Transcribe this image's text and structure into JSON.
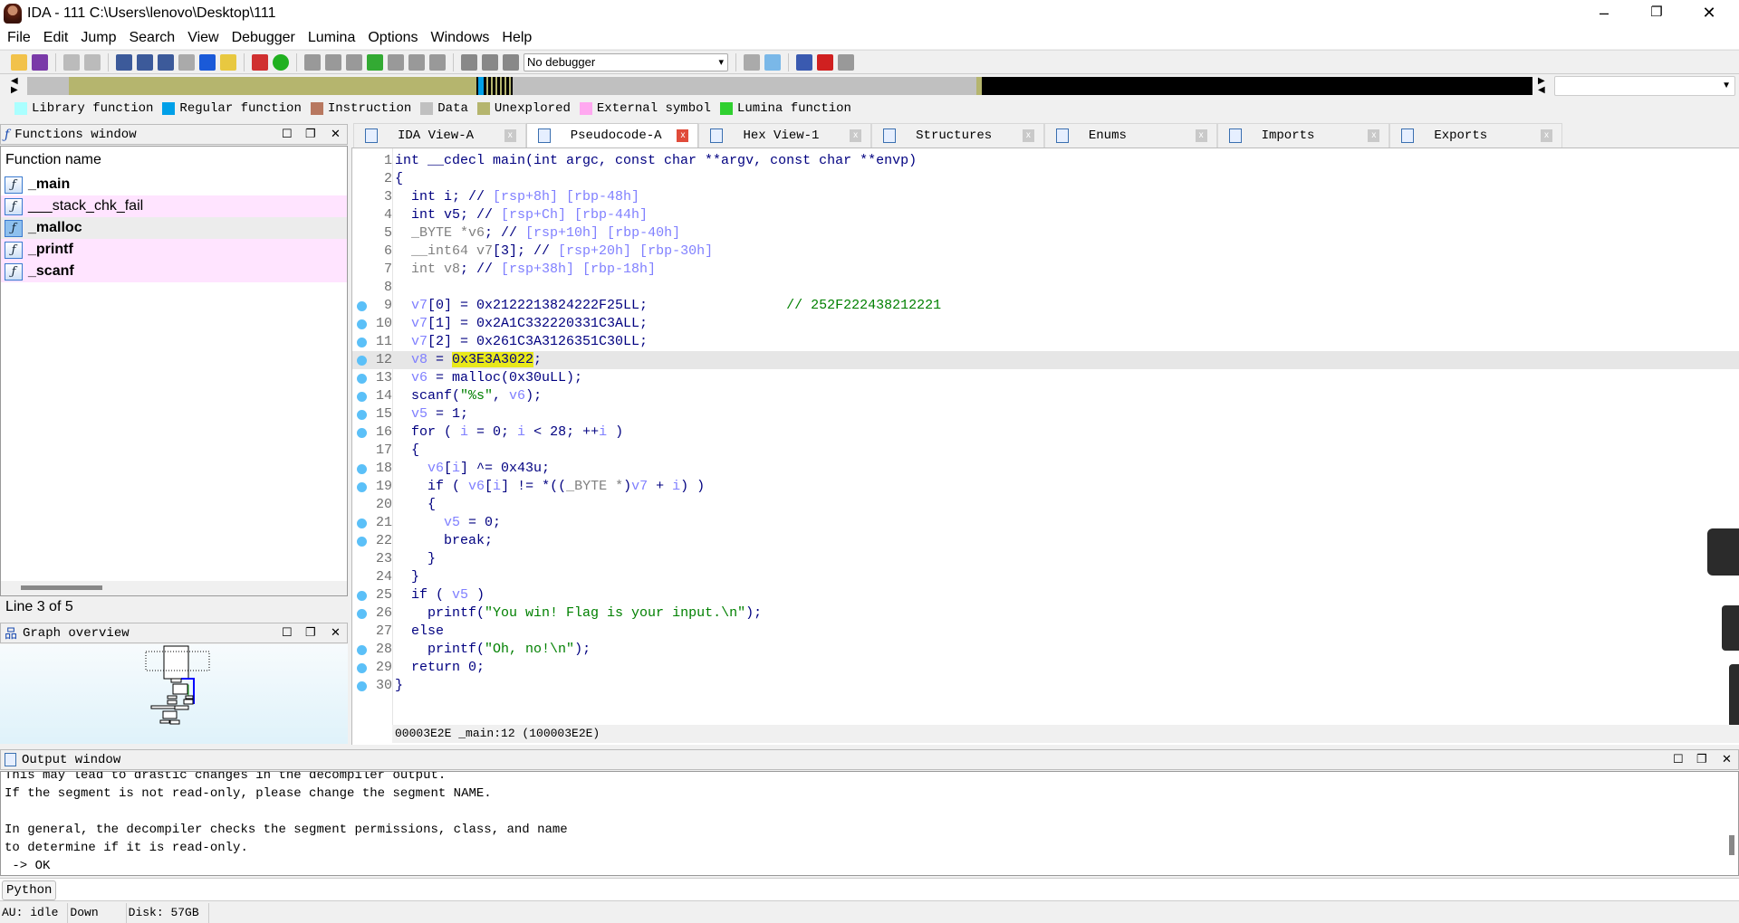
{
  "window": {
    "title": "IDA - 111 C:\\Users\\lenovo\\Desktop\\111",
    "minimize": "–",
    "maximize": "❐",
    "close": "✕"
  },
  "menu": [
    "File",
    "Edit",
    "Jump",
    "Search",
    "View",
    "Debugger",
    "Lumina",
    "Options",
    "Windows",
    "Help"
  ],
  "toolbar": {
    "debugger_select": "No debugger"
  },
  "legend": [
    {
      "label": "Library function",
      "color": "#aaffff"
    },
    {
      "label": "Regular function",
      "color": "#00a0e8"
    },
    {
      "label": "Instruction",
      "color": "#b87860"
    },
    {
      "label": "Data",
      "color": "#c0c0c0"
    },
    {
      "label": "Unexplored",
      "color": "#b5b56e"
    },
    {
      "label": "External symbol",
      "color": "#ffa8f0"
    },
    {
      "label": "Lumina function",
      "color": "#30d030"
    }
  ],
  "functions_window": {
    "title": "Functions window",
    "column": "Function name",
    "status": "Line 3 of 5",
    "items": [
      {
        "name": "_main",
        "bold": true,
        "bg": "#ffffff"
      },
      {
        "name": "___stack_chk_fail",
        "bold": false,
        "bg": "#ffe4ff"
      },
      {
        "name": "_malloc",
        "bold": true,
        "bg": "#ececec"
      },
      {
        "name": "_printf",
        "bold": true,
        "bg": "#ffe4ff"
      },
      {
        "name": "_scanf",
        "bold": true,
        "bg": "#ffe4ff"
      }
    ]
  },
  "graph_overview": {
    "title": "Graph overview"
  },
  "tabs": [
    {
      "label": "IDA View-A",
      "active": false
    },
    {
      "label": "Pseudocode-A",
      "active": true
    },
    {
      "label": "Hex View-1",
      "active": false
    },
    {
      "label": "Structures",
      "active": false
    },
    {
      "label": "Enums",
      "active": false
    },
    {
      "label": "Imports",
      "active": false
    },
    {
      "label": "Exports",
      "active": false
    }
  ],
  "code": {
    "current_line": 12,
    "lines": [
      {
        "n": 1,
        "bp": false,
        "seg": [
          [
            "k",
            "int __cdecl main(int argc, const char **argv, const char **envp)"
          ]
        ]
      },
      {
        "n": 2,
        "bp": false,
        "seg": [
          [
            "k",
            "{"
          ]
        ]
      },
      {
        "n": 3,
        "bp": false,
        "seg": [
          [
            "k",
            "  int i; // "
          ],
          [
            "cb",
            "[rsp+8h] [rbp-48h]"
          ]
        ]
      },
      {
        "n": 4,
        "bp": false,
        "seg": [
          [
            "k",
            "  int v5; // "
          ],
          [
            "cb",
            "[rsp+Ch] [rbp-44h]"
          ]
        ]
      },
      {
        "n": 5,
        "bp": false,
        "seg": [
          [
            "g",
            "  _BYTE *v6"
          ],
          [
            "k",
            "; // "
          ],
          [
            "cb",
            "[rsp+10h] [rbp-40h]"
          ]
        ]
      },
      {
        "n": 6,
        "bp": false,
        "seg": [
          [
            "g",
            "  __int64 v7"
          ],
          [
            "k",
            "[3]; // "
          ],
          [
            "cb",
            "[rsp+20h] [rbp-30h]"
          ]
        ]
      },
      {
        "n": 7,
        "bp": false,
        "seg": [
          [
            "g",
            "  int v8"
          ],
          [
            "k",
            "; // "
          ],
          [
            "cb",
            "[rsp+38h] [rbp-18h]"
          ]
        ]
      },
      {
        "n": 8,
        "bp": false,
        "seg": []
      },
      {
        "n": 9,
        "bp": true,
        "seg": [
          [
            "v",
            "  v7"
          ],
          [
            "k",
            "[0] = 0x2122213824222F25LL;                 "
          ],
          [
            "c",
            "// 252F222438212221"
          ]
        ]
      },
      {
        "n": 10,
        "bp": true,
        "seg": [
          [
            "v",
            "  v7"
          ],
          [
            "k",
            "[1] = 0x2A1C332220331C3ALL;"
          ]
        ]
      },
      {
        "n": 11,
        "bp": true,
        "seg": [
          [
            "v",
            "  v7"
          ],
          [
            "k",
            "[2] = 0x261C3A3126351C30LL;"
          ]
        ]
      },
      {
        "n": 12,
        "bp": true,
        "seg": [
          [
            "v",
            "  v8"
          ],
          [
            "k",
            " = "
          ],
          [
            "hl",
            "0x3E3A3022"
          ],
          [
            "k",
            ";"
          ]
        ]
      },
      {
        "n": 13,
        "bp": true,
        "seg": [
          [
            "v",
            "  v6"
          ],
          [
            "k",
            " = malloc(0x30uLL);"
          ]
        ]
      },
      {
        "n": 14,
        "bp": true,
        "seg": [
          [
            "k",
            "  scanf("
          ],
          [
            "s",
            "\"%s\""
          ],
          [
            "k",
            ", "
          ],
          [
            "v",
            "v6"
          ],
          [
            "k",
            ");"
          ]
        ]
      },
      {
        "n": 15,
        "bp": true,
        "seg": [
          [
            "v",
            "  v5"
          ],
          [
            "k",
            " = 1;"
          ]
        ]
      },
      {
        "n": 16,
        "bp": true,
        "seg": [
          [
            "k",
            "  for ( "
          ],
          [
            "v",
            "i"
          ],
          [
            "k",
            " = 0; "
          ],
          [
            "v",
            "i"
          ],
          [
            "k",
            " < 28; ++"
          ],
          [
            "v",
            "i"
          ],
          [
            "k",
            " )"
          ]
        ]
      },
      {
        "n": 17,
        "bp": false,
        "seg": [
          [
            "k",
            "  {"
          ]
        ]
      },
      {
        "n": 18,
        "bp": true,
        "seg": [
          [
            "v",
            "    v6"
          ],
          [
            "k",
            "["
          ],
          [
            "v",
            "i"
          ],
          [
            "k",
            "] ^= 0x43u;"
          ]
        ]
      },
      {
        "n": 19,
        "bp": true,
        "seg": [
          [
            "k",
            "    if ( "
          ],
          [
            "v",
            "v6"
          ],
          [
            "k",
            "["
          ],
          [
            "v",
            "i"
          ],
          [
            "k",
            "] != *(("
          ],
          [
            "g",
            "_BYTE *"
          ],
          [
            "k",
            ")"
          ],
          [
            "v",
            "v7"
          ],
          [
            "k",
            " + "
          ],
          [
            "v",
            "i"
          ],
          [
            "k",
            ") )"
          ]
        ]
      },
      {
        "n": 20,
        "bp": false,
        "seg": [
          [
            "k",
            "    {"
          ]
        ]
      },
      {
        "n": 21,
        "bp": true,
        "seg": [
          [
            "v",
            "      v5"
          ],
          [
            "k",
            " = 0;"
          ]
        ]
      },
      {
        "n": 22,
        "bp": true,
        "seg": [
          [
            "k",
            "      break;"
          ]
        ]
      },
      {
        "n": 23,
        "bp": false,
        "seg": [
          [
            "k",
            "    }"
          ]
        ]
      },
      {
        "n": 24,
        "bp": false,
        "seg": [
          [
            "k",
            "  }"
          ]
        ]
      },
      {
        "n": 25,
        "bp": true,
        "seg": [
          [
            "k",
            "  if ( "
          ],
          [
            "v",
            "v5"
          ],
          [
            "k",
            " )"
          ]
        ]
      },
      {
        "n": 26,
        "bp": true,
        "seg": [
          [
            "k",
            "    printf("
          ],
          [
            "s",
            "\"You win! Flag is your input.\\n\""
          ],
          [
            "k",
            ");"
          ]
        ]
      },
      {
        "n": 27,
        "bp": false,
        "seg": [
          [
            "k",
            "  else"
          ]
        ]
      },
      {
        "n": 28,
        "bp": true,
        "seg": [
          [
            "k",
            "    printf("
          ],
          [
            "s",
            "\"Oh, no!\\n\""
          ],
          [
            "k",
            ");"
          ]
        ]
      },
      {
        "n": 29,
        "bp": true,
        "seg": [
          [
            "k",
            "  return 0;"
          ]
        ]
      },
      {
        "n": 30,
        "bp": true,
        "seg": [
          [
            "k",
            "}"
          ]
        ]
      }
    ],
    "status": "00003E2E _main:12 (100003E2E)"
  },
  "output_window": {
    "title": "Output window",
    "lines": [
      "This may lead to drastic changes in the decompiler output.",
      "If the segment is not read-only, please change the segment NAME.",
      "",
      "In general, the decompiler checks the segment permissions, class, and name",
      "to determine if it is read-only.",
      " -> OK"
    ]
  },
  "python_button": "Python",
  "statusbar": {
    "au": "AU:  idle",
    "direction": "Down",
    "disk": "Disk: 57GB"
  }
}
